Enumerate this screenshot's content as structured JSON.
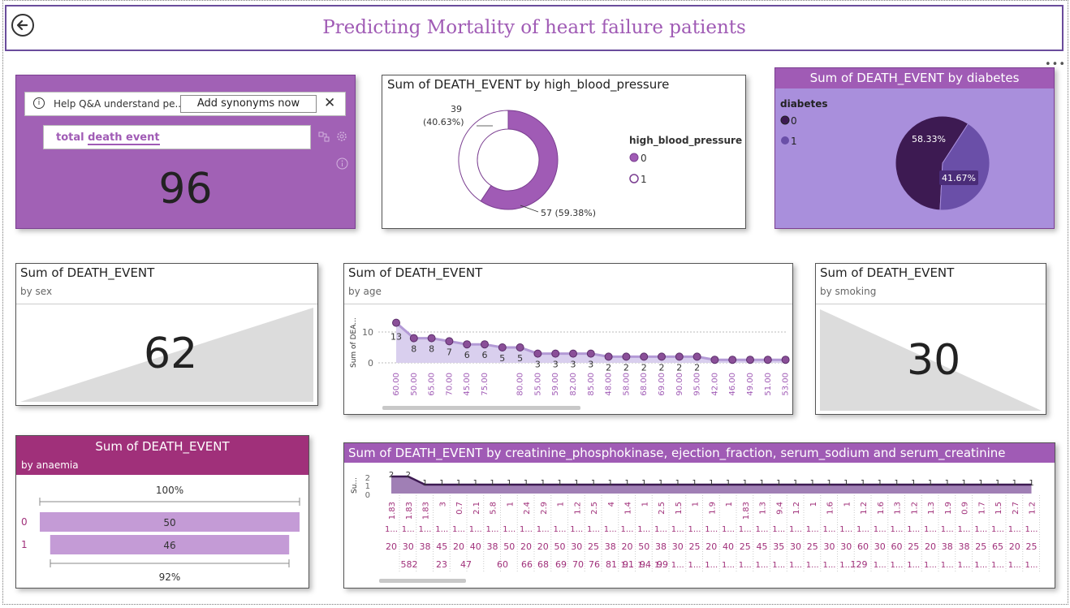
{
  "title": "Predicting Mortality of heart failure patients",
  "icons": {
    "back": "back-arrow-icon",
    "more": "more-options-icon"
  },
  "colors": {
    "accent": "#a05bb5",
    "dark_purple": "#3d1a52",
    "light_purple": "#c49bd6",
    "anaemia_header": "#a0307a",
    "diabetes_bg": "#a98fdc"
  },
  "qa": {
    "help_text": "Help Q&A understand pe...",
    "add_synonyms": "Add synonyms now",
    "close": "✕",
    "query_word1": "total",
    "query_word2": "death event",
    "value": "96",
    "icons": [
      "info-icon",
      "flow-icon",
      "settings-icon",
      "info-icon"
    ]
  },
  "hbp": {
    "title": "Sum of DEATH_EVENT by high_blood_pressure",
    "legend_title": "high_blood_pressure",
    "legend": [
      "0",
      "1"
    ],
    "label_1": "39",
    "label_1_pct": "(40.63%)",
    "label_0": "57 (59.38%)"
  },
  "diabetes": {
    "title": "Sum of DEATH_EVENT by diabetes",
    "legend_title": "diabetes",
    "legend": [
      "0",
      "1"
    ],
    "pct_0": "58.33%",
    "pct_1": "41.67%"
  },
  "sex": {
    "title": "Sum of DEATH_EVENT",
    "subtitle": "by sex",
    "value": "62"
  },
  "age": {
    "title": "Sum of DEATH_EVENT",
    "subtitle": "by age",
    "ylabel": "Sum of DEA...",
    "yticks": [
      "10",
      "0"
    ]
  },
  "smoking": {
    "title": "Sum of DEATH_EVENT",
    "subtitle": "by smoking",
    "value": "30"
  },
  "anaemia": {
    "title": "Sum of DEATH_EVENT",
    "subtitle": "by anaemia",
    "top_pct": "100%",
    "bottom_pct": "92%",
    "rows": [
      {
        "label": "0",
        "value": "50"
      },
      {
        "label": "1",
        "value": "46"
      }
    ]
  },
  "creatinine": {
    "title": "Sum of DEATH_EVENT by creatinine_phosphokinase, ejection_fraction, serum_sodium and serum_creatinine",
    "ylabel": "Su...",
    "yticks": [
      "2",
      "1",
      "0"
    ],
    "line_values": [
      "2",
      "2",
      "1",
      "1",
      "1",
      "1",
      "1",
      "1",
      "1",
      "1",
      "1",
      "1",
      "1",
      "1",
      "1",
      "1",
      "1",
      "1",
      "1",
      "1",
      "1",
      "1",
      "1",
      "1",
      "1",
      "1",
      "1",
      "1",
      "1",
      "1",
      "1",
      "1",
      "1",
      "1",
      "1",
      "1",
      "1",
      "1",
      "1",
      "1",
      "1",
      "1",
      "1",
      "1",
      "1",
      "1",
      "1",
      "1",
      "1",
      "1",
      "1",
      "1",
      "1",
      "1",
      "1",
      "1",
      "1",
      "1",
      "1",
      "1",
      "1",
      "1",
      "1",
      "1",
      "1",
      "1",
      "1",
      "1",
      "1",
      "1",
      "1",
      "1",
      "1",
      "1",
      "1",
      "1",
      "1",
      "1",
      "1",
      "1",
      "1",
      "1",
      "1",
      "1",
      "1",
      "1",
      "1",
      "1"
    ],
    "row1": [
      "1.83",
      "1.83",
      "1.83",
      "3",
      "0.7",
      "2.1",
      "5.8",
      "1",
      "2.4",
      "2.9",
      "1",
      "1.2",
      "2.5",
      "4",
      "1.4",
      "1",
      "2.5",
      "1.5",
      "1",
      "1.9",
      "1",
      "1.83",
      "1.3",
      "9.4",
      "1.2",
      "1",
      "1.6",
      "1",
      "1.2",
      "1.6",
      "1.3",
      "1.2",
      "1.3",
      "1.9",
      "0.9",
      "1.7",
      "1.5",
      "2.7",
      "1.2"
    ],
    "row3": [
      "20",
      "30",
      "38",
      "45",
      "20",
      "40",
      "38",
      "50",
      "20",
      "20",
      "50",
      "30",
      "25",
      "38",
      "20",
      "50",
      "38",
      "30",
      "25",
      "20",
      "40",
      "25",
      "45",
      "35",
      "30",
      "25",
      "30",
      "30",
      "60",
      "30",
      "60",
      "25",
      "20",
      "38",
      "38",
      "25",
      "65",
      "20",
      "25"
    ],
    "row4": [
      "582",
      "23",
      "47",
      "60",
      "66",
      "68",
      "69",
      "70",
      "76",
      "81",
      "91",
      "94",
      "99",
      "129"
    ]
  },
  "chart_data": [
    {
      "type": "pie",
      "title": "Sum of DEATH_EVENT by high_blood_pressure",
      "categories": [
        "0",
        "1"
      ],
      "values": [
        57,
        39
      ],
      "percentages": [
        59.38,
        40.63
      ],
      "legend": "right"
    },
    {
      "type": "pie",
      "title": "Sum of DEATH_EVENT by diabetes",
      "categories": [
        "0",
        "1"
      ],
      "values": [
        58.33,
        41.67
      ],
      "legend": "left"
    },
    {
      "type": "area",
      "title": "Sum of DEATH_EVENT",
      "subtitle": "by age",
      "ylabel": "Sum of DEA...",
      "categories": [
        "60.00",
        "50.00",
        "65.00",
        "70.00",
        "45.00",
        "75.00",
        "",
        "80.00",
        "55.00",
        "59.00",
        "82.00",
        "85.00",
        "48.00",
        "58.00",
        "68.00",
        "69.00",
        "90.00",
        "95.00",
        "42.00",
        "46.00",
        "49.00",
        "51.00",
        "53.00"
      ],
      "values": [
        13,
        8,
        8,
        7,
        6,
        6,
        5,
        5,
        3,
        3,
        3,
        3,
        2,
        2,
        2,
        2,
        2,
        2,
        1,
        1,
        1,
        1,
        1
      ],
      "data_labels": [
        "13",
        "8",
        "8",
        "7",
        "6",
        "6",
        "5",
        "5",
        "3",
        "3",
        "3",
        "3",
        "2",
        "2",
        "2",
        "2",
        "2",
        "2",
        "",
        "",
        "",
        "",
        ""
      ],
      "ylim": [
        0,
        13
      ],
      "grid": true
    },
    {
      "type": "bar",
      "title": "Sum of DEATH_EVENT",
      "subtitle": "by anaemia",
      "categories": [
        "0",
        "1"
      ],
      "values": [
        50,
        46
      ]
    },
    {
      "type": "line",
      "title": "Sum of DEATH_EVENT by creatinine_phosphokinase, ejection_fraction, serum_sodium and serum_creatinine",
      "ylabel": "Su...",
      "values": [
        2,
        2,
        1,
        1,
        1,
        1,
        1,
        1,
        1,
        1,
        1,
        1,
        1,
        1,
        1,
        1,
        1,
        1,
        1,
        1,
        1,
        1,
        1,
        1,
        1,
        1,
        1,
        1,
        1,
        1,
        1,
        1,
        1,
        1,
        1,
        1,
        1,
        1,
        1
      ],
      "ylim": [
        0,
        2
      ]
    }
  ]
}
